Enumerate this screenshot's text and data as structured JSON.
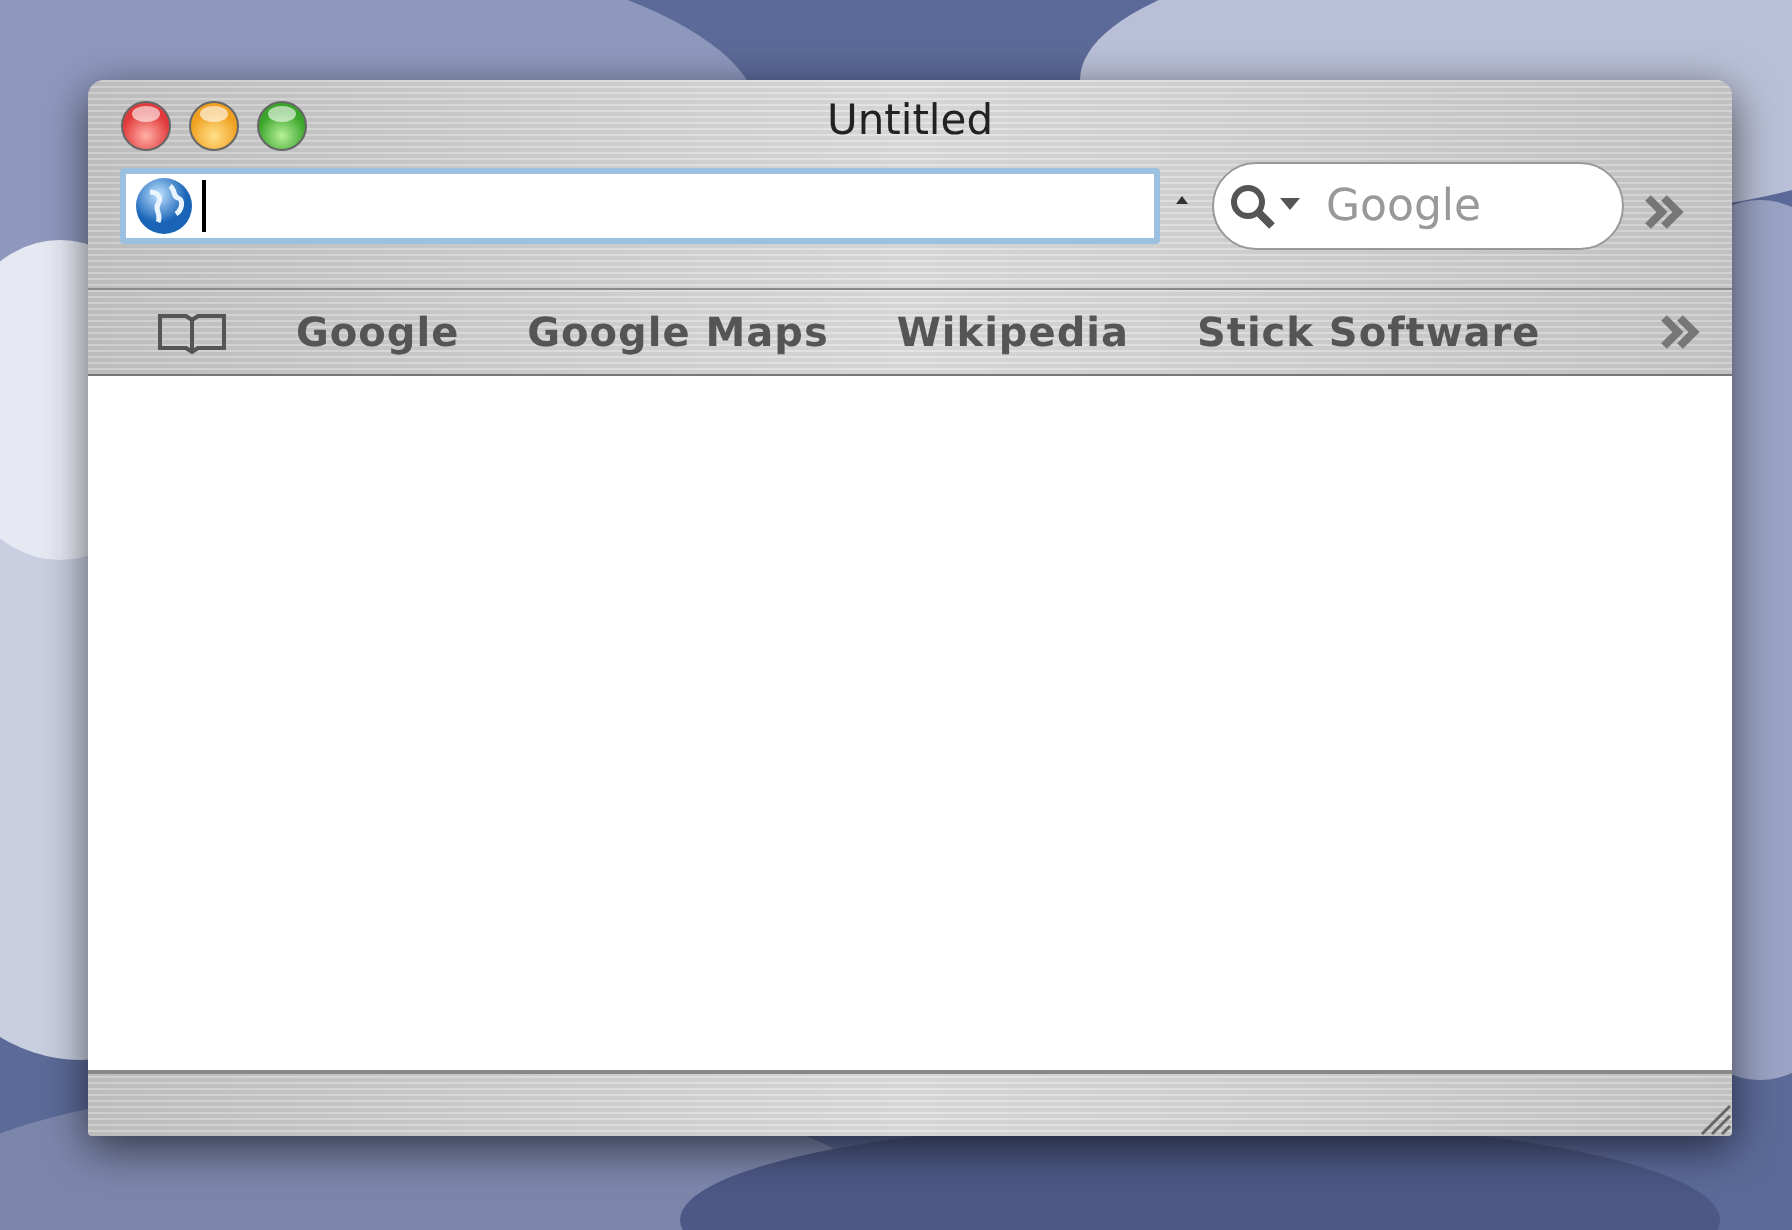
{
  "window": {
    "title": "Untitled"
  },
  "search_field": {
    "placeholder": "Google"
  },
  "bookmarks": [
    {
      "label": "Google"
    },
    {
      "label": "Google Maps"
    },
    {
      "label": "Wikipedia"
    },
    {
      "label": "Stick Software"
    }
  ]
}
